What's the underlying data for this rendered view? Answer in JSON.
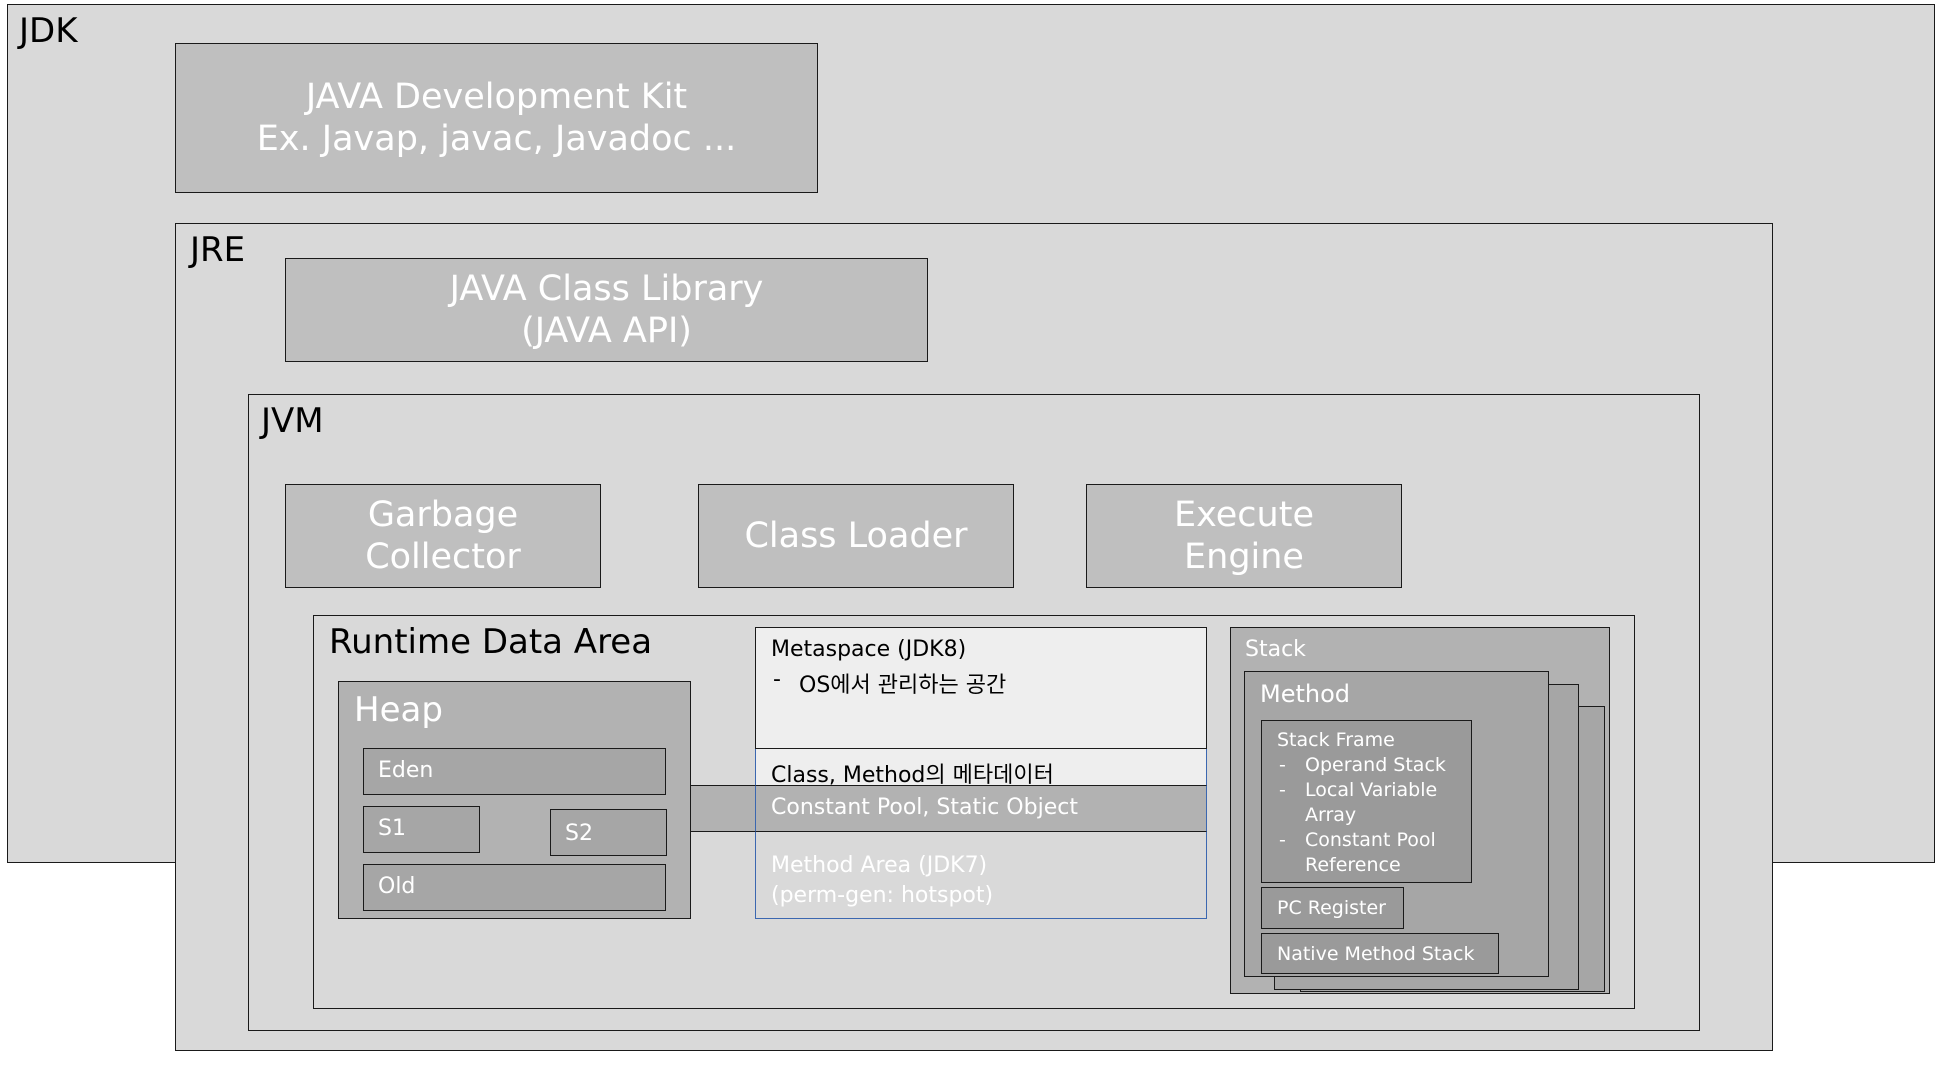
{
  "jdk": {
    "label": "JDK",
    "dev_kit": {
      "line1": "JAVA Development Kit",
      "line2": "Ex. Javap, javac, Javadoc ..."
    }
  },
  "jre": {
    "label": "JRE",
    "class_library": {
      "line1": "JAVA Class Library",
      "line2": "(JAVA API)"
    }
  },
  "jvm": {
    "label": "JVM",
    "garbage_collector": {
      "line1": "Garbage",
      "line2": "Collector"
    },
    "class_loader": "Class Loader",
    "execute_engine": {
      "line1": "Execute",
      "line2": "Engine"
    }
  },
  "runtime": {
    "label": "Runtime Data Area",
    "heap": {
      "label": "Heap",
      "eden": "Eden",
      "s1": "S1",
      "s2": "S2",
      "old": "Old"
    },
    "metaspace": {
      "title": "Metaspace (JDK8)",
      "bullet_dash": "-",
      "bullet": "OS에서 관리하는 공간"
    },
    "class_method_meta": "Class, Method의 메타데이터",
    "constant_pool": "Constant Pool, Static Object",
    "method_area": {
      "line1": "Method Area (JDK7)",
      "line2": "(perm-gen: hotspot)"
    },
    "stack": {
      "label": "Stack",
      "method": "Method",
      "stack_frame": {
        "title": "Stack Frame",
        "items": [
          {
            "dash": "-",
            "line1": "Operand Stack",
            "line2": ""
          },
          {
            "dash": "-",
            "line1": "Local Variable",
            "line2": "Array"
          },
          {
            "dash": "-",
            "line1": "Constant Pool",
            "line2": "Reference"
          }
        ]
      },
      "pc_register": "PC Register",
      "native_method_stack": "Native Method Stack"
    }
  }
}
